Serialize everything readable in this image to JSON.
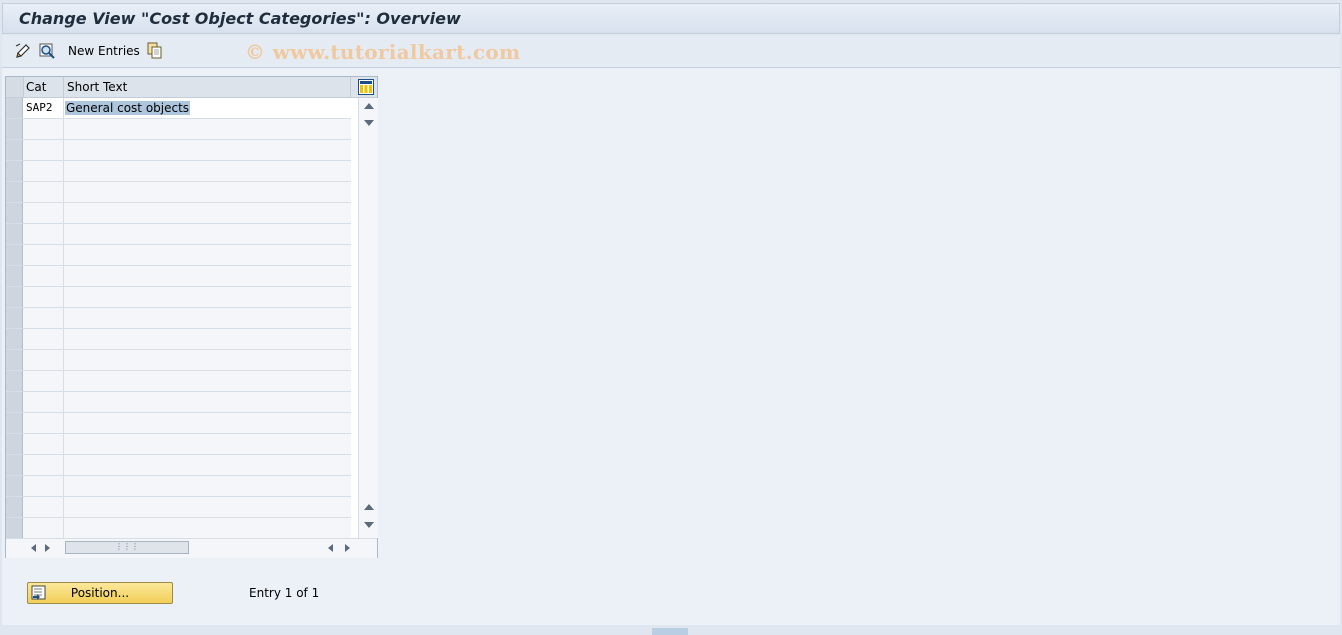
{
  "window": {
    "title": "Change View \"Cost Object Categories\": Overview"
  },
  "toolbar": {
    "new_entries_label": "New Entries",
    "icons": [
      "display-change-icon",
      "details-icon",
      "copy-icon"
    ]
  },
  "watermark": "© www.tutorialkart.com",
  "table": {
    "columns": [
      "Cat",
      "Short Text"
    ],
    "rows": [
      {
        "cat": "SAP2",
        "short_text": "General cost objects"
      }
    ],
    "empty_rows": 20
  },
  "footer": {
    "position_button": "Position...",
    "entry_info": "Entry 1 of 1"
  },
  "colors": {
    "background": "#ecf0f7",
    "title_bar": "#d7e1ed",
    "selection_highlight": "#aec6dd",
    "button_yellow": "#f2cf58"
  }
}
